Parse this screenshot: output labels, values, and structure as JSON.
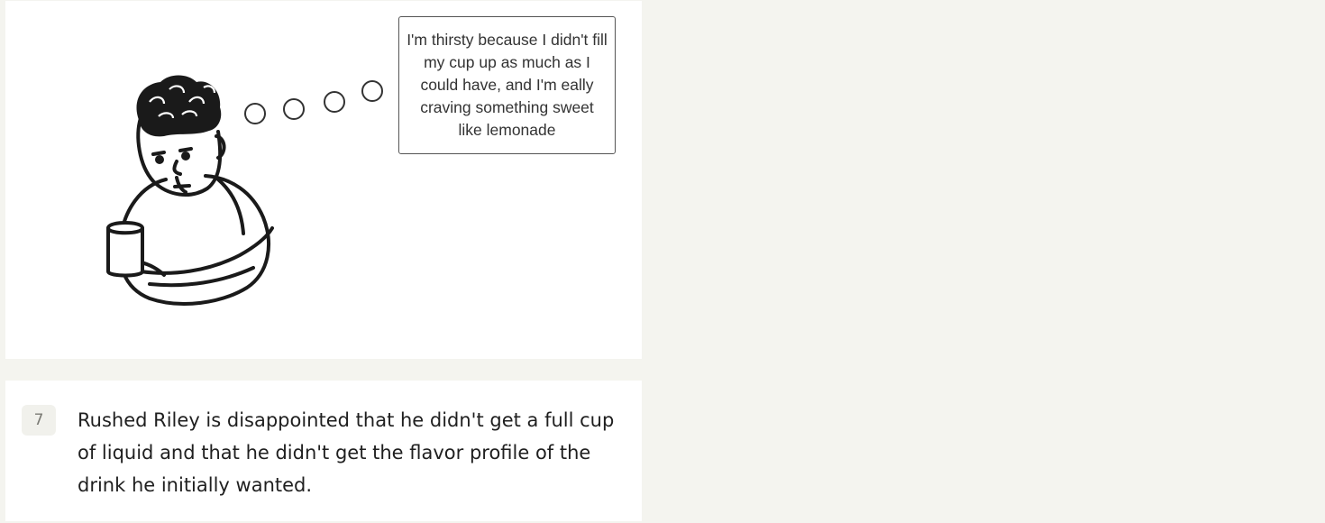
{
  "illustration": {
    "figure_icon": "thinking-person-holding-cup-icon",
    "thought_bubble_text": "I'm thirsty because I didn't fill my cup up as much as I could have, and I'm eally craving something sweet like lemonade"
  },
  "step": {
    "number": "7",
    "text": "Rushed Riley is disappointed that he didn't get a full cup of liquid and that he didn't get the flavor profile of the drink he initially wanted."
  },
  "colors": {
    "page_background": "#f4f4ef",
    "card_background": "#ffffff",
    "ink": "#1f1f1f",
    "badge_background": "#f1f1ec"
  }
}
